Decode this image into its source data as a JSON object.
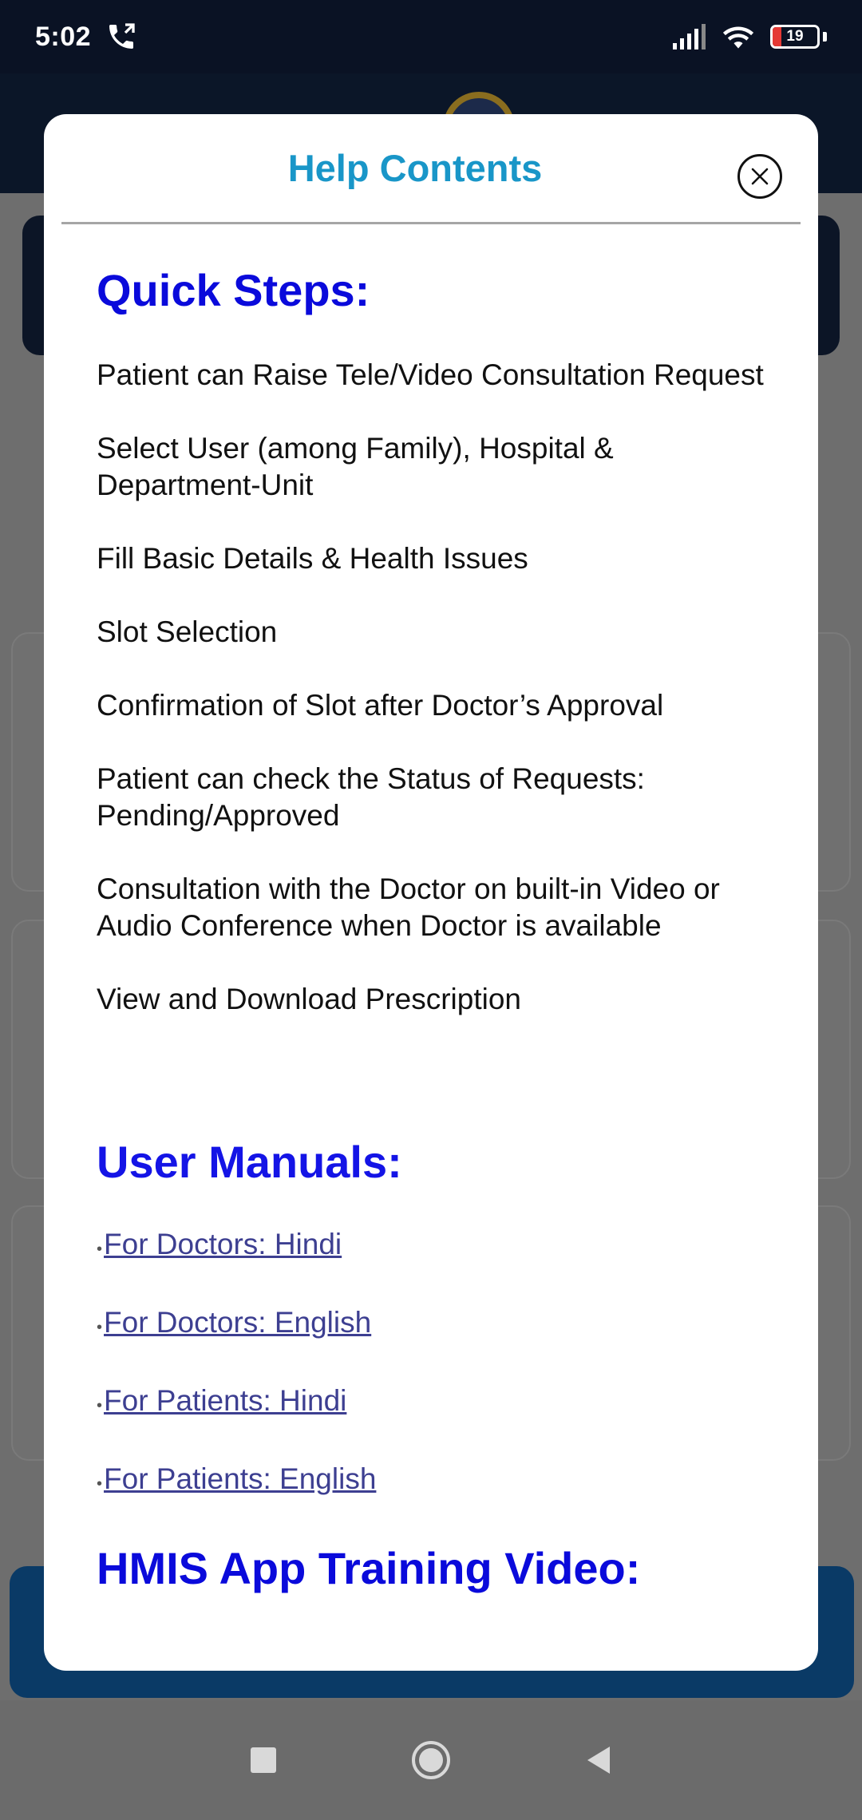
{
  "status_bar": {
    "time": "5:02",
    "call_icon": "call-forward-icon",
    "signal_icon": "signal-icon",
    "wifi_icon": "wifi-icon",
    "battery_level": "19"
  },
  "modal": {
    "title": "Help Contents",
    "close_icon": "close-icon",
    "quick_steps": {
      "heading": "Quick Steps:",
      "items": [
        "Patient can Raise Tele/Video Consultation Request",
        "Select User (among Family), Hospital & Department-Unit",
        "Fill Basic Details & Health Issues",
        "Slot Selection",
        "Confirmation of Slot after Doctor’s Approval",
        "Patient can check the Status of Requests: Pending/Approved",
        "Consultation with the Doctor on built-in Video or Audio Conference when Doctor is available",
        "View and Download Prescription"
      ]
    },
    "user_manuals": {
      "heading": "User Manuals:",
      "bullet": "•",
      "links": [
        "For Doctors: Hindi",
        "For Doctors: English",
        "For Patients: Hindi",
        "For Patients: English"
      ]
    },
    "training_video": {
      "heading": "HMIS App Training Video:"
    }
  },
  "nav_bar": {
    "recents_icon": "square-recents-icon",
    "home_icon": "circle-home-icon",
    "back_icon": "triangle-back-icon"
  }
}
